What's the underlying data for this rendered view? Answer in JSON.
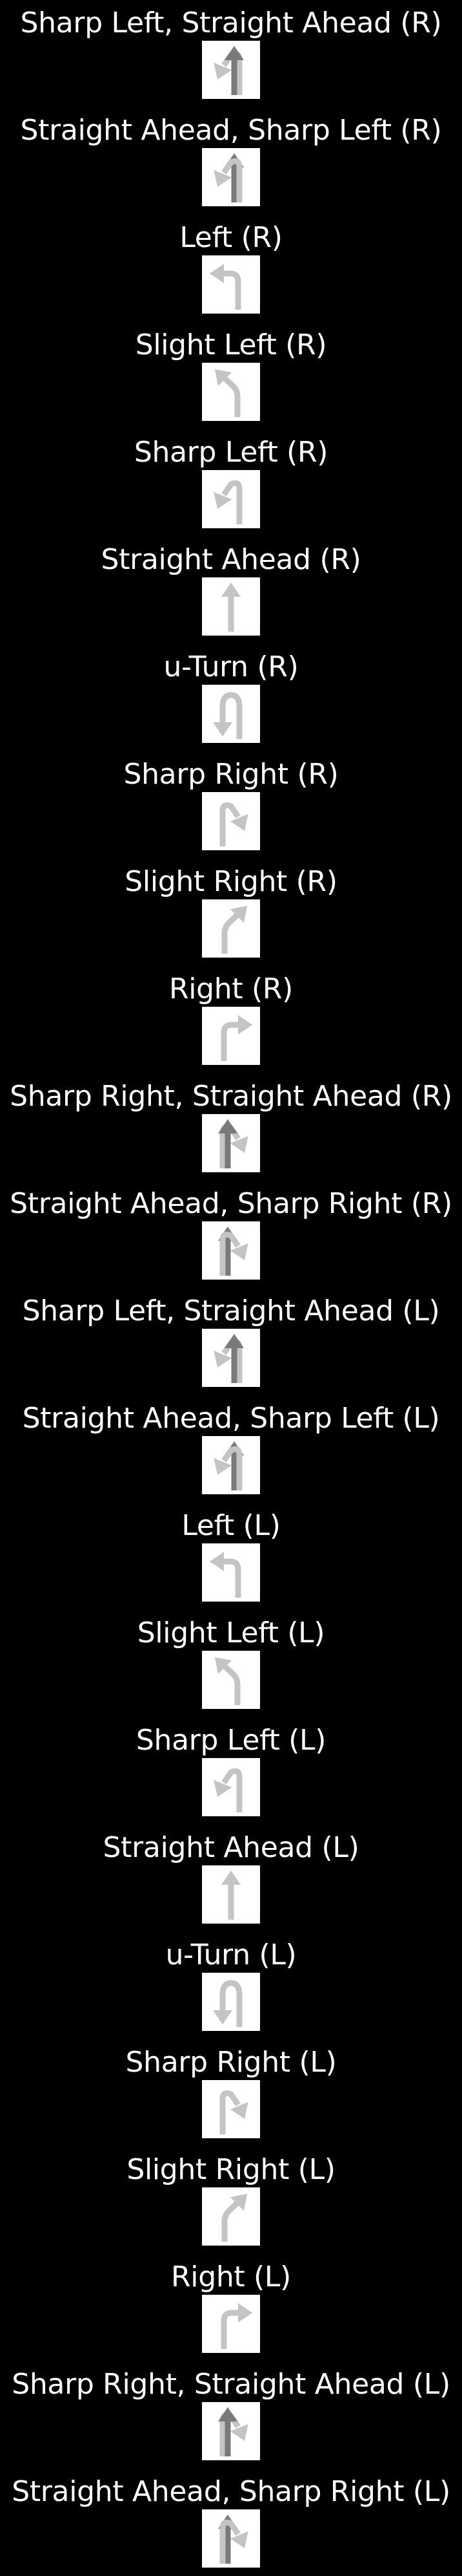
{
  "colors": {
    "background": "#000000",
    "text": "#ffffff",
    "tile": "#ffffff",
    "arrow_primary": "#7a7a7a",
    "arrow_secondary": "#c4c4c4"
  },
  "items": [
    {
      "label": "Sharp Left, Straight Ahead (R)",
      "icon": "sharp-left-straight-ahead-icon"
    },
    {
      "label": "Straight Ahead, Sharp Left (R)",
      "icon": "straight-ahead-sharp-left-icon"
    },
    {
      "label": "Left (R)",
      "icon": "left-icon"
    },
    {
      "label": "Slight Left (R)",
      "icon": "slight-left-icon"
    },
    {
      "label": "Sharp Left (R)",
      "icon": "sharp-left-icon"
    },
    {
      "label": "Straight Ahead (R)",
      "icon": "straight-ahead-icon"
    },
    {
      "label": "u-Turn (R)",
      "icon": "u-turn-icon"
    },
    {
      "label": "Sharp Right (R)",
      "icon": "sharp-right-icon"
    },
    {
      "label": "Slight Right (R)",
      "icon": "slight-right-icon"
    },
    {
      "label": "Right (R)",
      "icon": "right-icon"
    },
    {
      "label": "Sharp Right, Straight Ahead (R)",
      "icon": "sharp-right-straight-ahead-icon"
    },
    {
      "label": "Straight Ahead, Sharp Right (R)",
      "icon": "straight-ahead-sharp-right-icon"
    },
    {
      "label": "Sharp Left, Straight Ahead (L)",
      "icon": "sharp-left-straight-ahead-icon"
    },
    {
      "label": "Straight Ahead, Sharp Left (L)",
      "icon": "straight-ahead-sharp-left-icon"
    },
    {
      "label": "Left (L)",
      "icon": "left-icon"
    },
    {
      "label": "Slight Left (L)",
      "icon": "slight-left-icon"
    },
    {
      "label": "Sharp Left (L)",
      "icon": "sharp-left-icon"
    },
    {
      "label": "Straight Ahead (L)",
      "icon": "straight-ahead-icon"
    },
    {
      "label": "u-Turn (L)",
      "icon": "u-turn-icon"
    },
    {
      "label": "Sharp Right (L)",
      "icon": "sharp-right-icon"
    },
    {
      "label": "Slight Right (L)",
      "icon": "slight-right-icon"
    },
    {
      "label": "Right (L)",
      "icon": "right-icon"
    },
    {
      "label": "Sharp Right, Straight Ahead (L)",
      "icon": "sharp-right-straight-ahead-icon"
    },
    {
      "label": "Straight Ahead, Sharp Right (L)",
      "icon": "straight-ahead-sharp-right-icon"
    }
  ]
}
